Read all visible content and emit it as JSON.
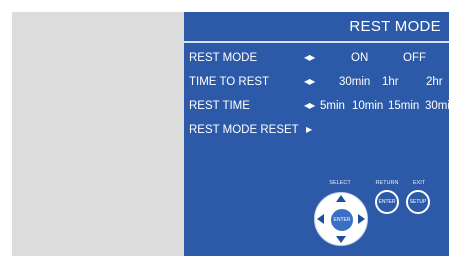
{
  "screen": {
    "title": "REST MODE",
    "colors": {
      "panel_bg": "#2c5aa8",
      "text": "#ffffff",
      "page_gutter": "#dcdcdc"
    }
  },
  "menu": {
    "rows": [
      {
        "label": "REST MODE",
        "has_left_arrow": true,
        "options": [
          "ON",
          "OFF"
        ]
      },
      {
        "label": "TIME TO REST",
        "has_left_arrow": true,
        "options": [
          "30min",
          "1hr",
          "2hr"
        ]
      },
      {
        "label": "REST TIME",
        "has_left_arrow": true,
        "options": [
          "5min",
          "10min",
          "15min",
          "30mi"
        ]
      },
      {
        "label": "REST MODE RESET",
        "has_left_arrow": false,
        "options": []
      }
    ]
  },
  "keys": {
    "select_caption": "SELECT",
    "return_caption": "RETURN",
    "exit_caption": "EXIT",
    "center_label": "ENTER",
    "return_label": "ENTER",
    "exit_label": "SETUP"
  }
}
